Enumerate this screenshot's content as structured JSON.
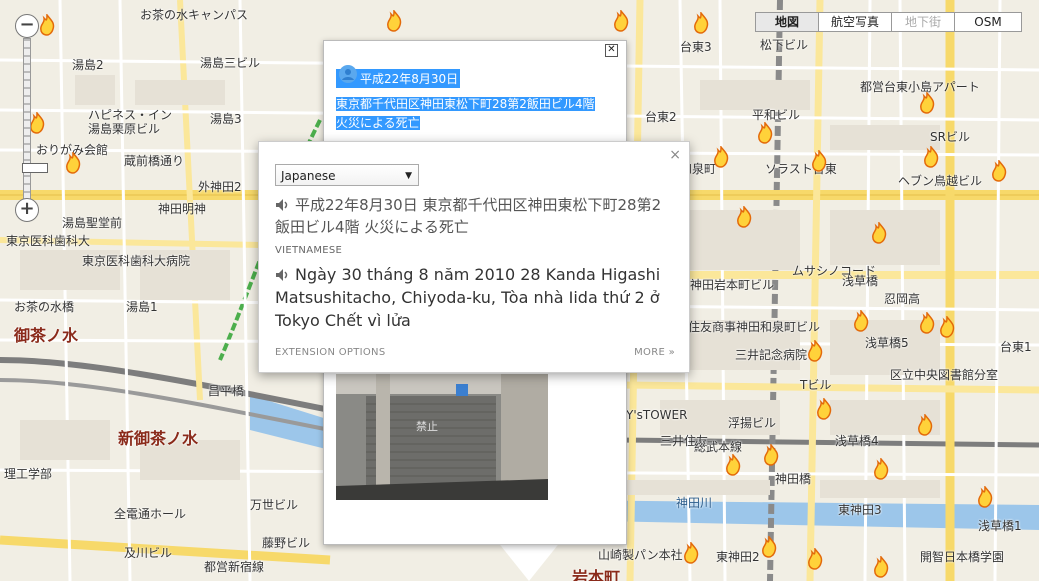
{
  "map_types": [
    "地図",
    "航空写真",
    "地下街",
    "OSM"
  ],
  "map_labels": [
    "お茶の水キャンパス",
    "湯島2",
    "湯島三ビル",
    "湯島3",
    "ハピネス・イン",
    "湯島栗原ビル",
    "おりがみ会館",
    "蔵前橋通り",
    "外神田2",
    "神田明神",
    "湯島聖堂前",
    "東京医科歯科大",
    "東京医科歯科大病院",
    "お茶の水橋",
    "湯島1",
    "御茶ノ水",
    "昌平橋",
    "新御茶ノ水",
    "理工学部",
    "全電通ホール",
    "及川ビル",
    "都営新宿線",
    "万世ビル",
    "藤野ビル",
    "台東3",
    "台東2",
    "松下ビル",
    "都営台東小島アパート",
    "平和ビル",
    "ソラスト台東",
    "ヘブン鳥越ビル",
    "浅草橋",
    "忍岡高",
    "ムサシノコード",
    "浅草橋5",
    "住友商事神田和泉町ビル",
    "三井記念病院",
    "区立中央図書館分室",
    "浅草橋4",
    "三井住友",
    "総武本線",
    "神田川",
    "東神田3",
    "東神田2",
    "浅草橋1",
    "開智日本橋学園",
    "山崎製パン本社",
    "岩本町",
    "台東1",
    "和泉町",
    "Y'sTOWER",
    "浮揚ビル",
    "神田橋",
    "Tビル",
    "SRビル",
    "神田岩本町ビル"
  ],
  "info_window": {
    "date": "平成22年8月30日",
    "address_line": "東京都千代田区神田東松下町28第2飯田ビル4階",
    "description": "火災による死亡",
    "photo_sign": "禁止"
  },
  "translate": {
    "source_language": "Japanese",
    "source_text": "平成22年8月30日 東京都千代田区神田東松下町28第2飯田ビル4階 火災による死亡",
    "target_language_label": "VIETNAMESE",
    "translated_text": "Ngày 30 tháng 8 năm 2010 28 Kanda Higashi Matsushitacho, Chiyoda-ku, Tòa nhà Iida thứ 2 ở Tokyo Chết vì lửa",
    "extension_options": "EXTENSION OPTIONS",
    "more": "MORE »",
    "close": "×"
  },
  "zoom": {
    "in": "+",
    "out": "−"
  },
  "colors": {
    "selection": "#3399ff",
    "road_main": "#f7d96a",
    "rail": "#7d7d7d",
    "river": "#9cc6ea",
    "green_line": "#4cae4c"
  }
}
